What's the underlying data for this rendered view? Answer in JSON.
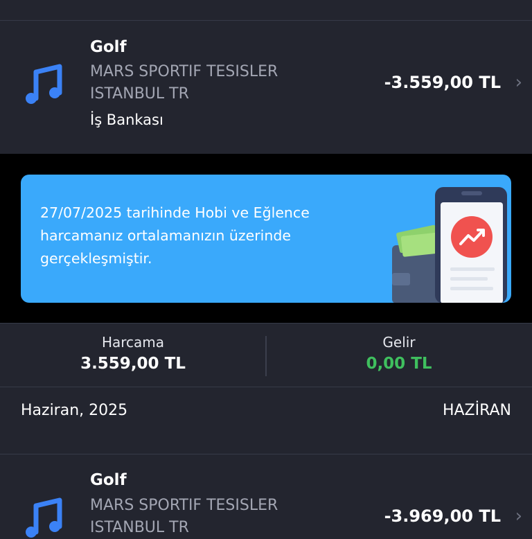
{
  "transactions": [
    {
      "name": "Golf",
      "merchant": "MARS SPORTIF TESISLER ISTANBUL TR",
      "bank": "İş Bankası",
      "amount": "-3.559,00 TL",
      "icon": "music-note-icon"
    },
    {
      "name": "Golf",
      "merchant": "MARS SPORTIF TESISLER ISTANBUL TR",
      "amount": "-3.969,00 TL",
      "icon": "music-note-icon"
    }
  ],
  "banner": {
    "text": "27/07/2025 tarihinde Hobi ve Eğlence harcamanız ortalamanızın üzerinde gerçekleşmiştir.",
    "illustration": "wallet-phone-trend-up-illustration"
  },
  "summary": {
    "spend_label": "Harcama",
    "spend_value": "3.559,00 TL",
    "income_label": "Gelir",
    "income_value": "0,00 TL"
  },
  "month_header": {
    "left": "Haziran, 2025",
    "right": "HAZİRAN"
  },
  "colors": {
    "background": "#23252f",
    "banner": "#3aa9fb",
    "income_green": "#3fbf5e",
    "icon_blue": "#3b82f6",
    "trend_red": "#f0524f"
  }
}
